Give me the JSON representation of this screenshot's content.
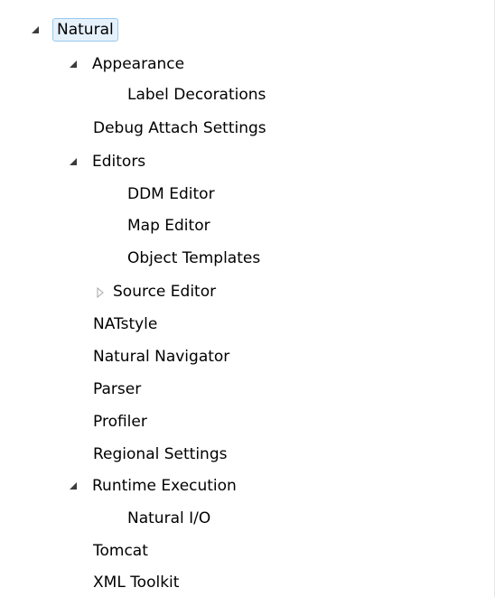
{
  "tree": {
    "root": {
      "label": "Natural",
      "expanded": true,
      "selected": true
    },
    "items": {
      "appearance": {
        "label": "Appearance",
        "expanded": true
      },
      "label_decorations": {
        "label": "Label Decorations"
      },
      "debug_attach_settings": {
        "label": "Debug Attach Settings"
      },
      "editors": {
        "label": "Editors",
        "expanded": true
      },
      "ddm_editor": {
        "label": "DDM Editor"
      },
      "map_editor": {
        "label": "Map Editor"
      },
      "object_templates": {
        "label": "Object Templates"
      },
      "source_editor": {
        "label": "Source Editor",
        "expanded": false
      },
      "natstyle": {
        "label": "NATstyle"
      },
      "natural_navigator": {
        "label": "Natural Navigator"
      },
      "parser": {
        "label": "Parser"
      },
      "profiler": {
        "label": "Profiler"
      },
      "regional_settings": {
        "label": "Regional Settings"
      },
      "runtime_execution": {
        "label": "Runtime Execution",
        "expanded": true
      },
      "natural_io": {
        "label": "Natural I/O"
      },
      "tomcat": {
        "label": "Tomcat"
      },
      "xml_toolkit": {
        "label": "XML Toolkit"
      }
    }
  },
  "colors": {
    "selection_fill": "#e5f1fb",
    "selection_border": "#99c9ef",
    "expanded_arrow": "#3c3c3c",
    "collapsed_arrow": "#a6a6a6"
  }
}
